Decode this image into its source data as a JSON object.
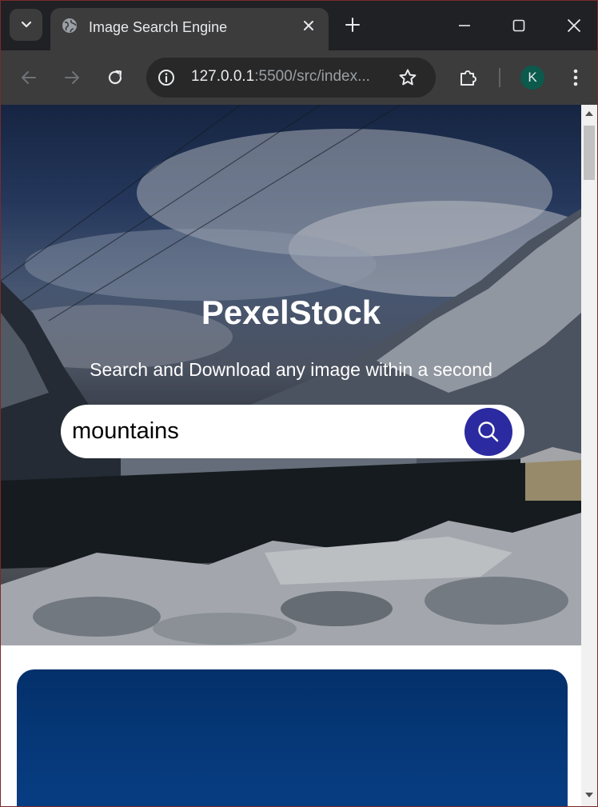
{
  "browser": {
    "tab": {
      "title": "Image Search Engine",
      "favicon": "globe-icon"
    },
    "omnibox": {
      "url_host": "127.0.0.1",
      "url_rest": ":5500/src/index..."
    },
    "profile_initial": "K",
    "profile_color": "#0b5a4c"
  },
  "hero": {
    "title": "PexelStock",
    "subtitle": "Search and Download any image within a second"
  },
  "search": {
    "value": "mountains",
    "button_color": "#2b2aa0"
  },
  "results": {
    "first_card_color": "#04306a"
  }
}
